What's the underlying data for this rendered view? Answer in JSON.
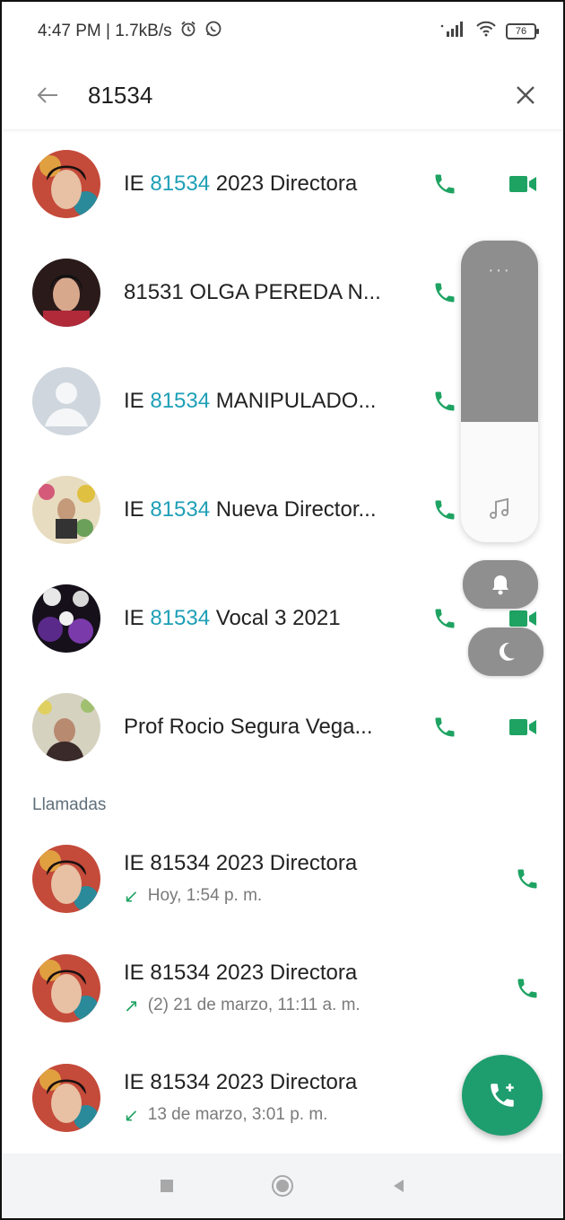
{
  "status_bar": {
    "time_speed": "4:47 PM | 1.7kB/s",
    "alarm_icon": "alarm-clock-icon",
    "whatsapp_icon": "whatsapp-icon",
    "battery": "76"
  },
  "search": {
    "query": "81534",
    "back_icon": "arrow-left-icon",
    "clear_icon": "close-icon"
  },
  "contacts": [
    {
      "prefix": "IE ",
      "highlight": "81534",
      "suffix": " 2023 Directora",
      "avatar_color": "#5a3a3a"
    },
    {
      "prefix": "81531 OLGA PEREDA N...",
      "highlight": "",
      "suffix": "",
      "avatar_color": "#8a2a3a"
    },
    {
      "prefix": "IE ",
      "highlight": "81534",
      "suffix": " MANIPULADO...",
      "avatar_color": "#c9d0d8"
    },
    {
      "prefix": "IE ",
      "highlight": "81534",
      "suffix": " Nueva Director...",
      "avatar_color": "#b89a6a"
    },
    {
      "prefix": "IE ",
      "highlight": "81534",
      "suffix": " Vocal 3 2021",
      "avatar_color": "#4b2d6a"
    },
    {
      "prefix": "Prof Rocio Segura Vega...",
      "highlight": "",
      "suffix": "",
      "avatar_color": "#8a7a6a"
    }
  ],
  "calls_section_label": "Llamadas",
  "calls": [
    {
      "name": "IE 81534 2023 Directora",
      "arrow": "↙",
      "detail": "Hoy, 1:54 p. m."
    },
    {
      "name": "IE 81534 2023 Directora",
      "arrow": "↗",
      "detail": "(2)  21 de marzo, 11:11 a. m."
    },
    {
      "name": "IE 81534 2023 Directora",
      "arrow": "↙",
      "detail": "13 de marzo, 3:01 p. m."
    }
  ],
  "volume": {
    "level_percent": 40,
    "menu_dots": "···",
    "music_icon": "music-note-icon",
    "bell_icon": "bell-icon",
    "moon_icon": "moon-icon"
  },
  "colors": {
    "accent_green": "#1ea362",
    "highlight_blue": "#1e9fb6",
    "fab_green": "#1e9d6e"
  },
  "fab": {
    "icon": "add-call-icon"
  },
  "nav": {
    "recents_icon": "square-icon",
    "home_icon": "circle-icon",
    "back_icon": "triangle-back-icon"
  }
}
